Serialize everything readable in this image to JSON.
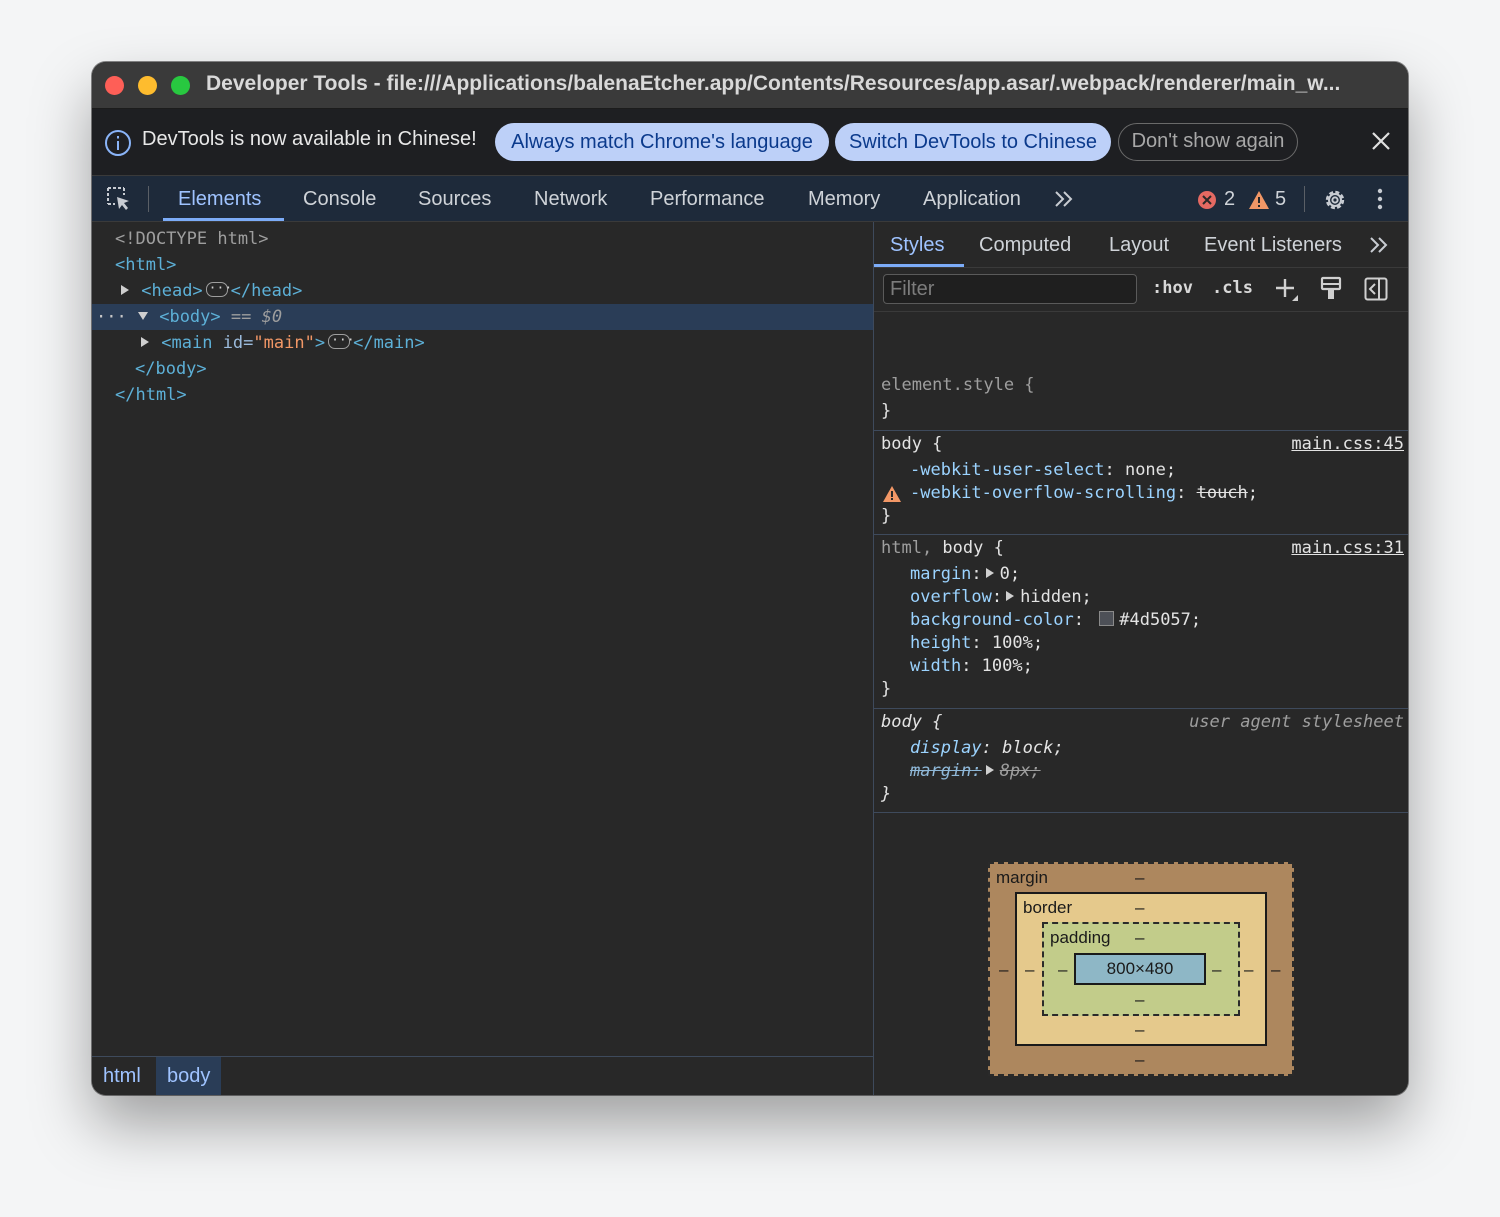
{
  "window": {
    "title": "Developer Tools - file:///Applications/balenaEtcher.app/Contents/Resources/app.asar/.webpack/renderer/main_w..."
  },
  "infobar": {
    "message": "DevTools is now available in Chinese!",
    "buttons": [
      "Always match Chrome's language",
      "Switch DevTools to Chinese",
      "Don't show again"
    ]
  },
  "tabs": [
    "Elements",
    "Console",
    "Sources",
    "Network",
    "Performance",
    "Memory",
    "Application"
  ],
  "active_tab": "Elements",
  "counts": {
    "errors": "2",
    "warnings": "5"
  },
  "dom": {
    "doctype": "<!DOCTYPE html>",
    "html_open": "<html>",
    "head_open": "<head>",
    "head_close": "</head>",
    "body_open": "<body>",
    "body_marker": " == $0",
    "main_tag": "<main",
    "main_attr": "id",
    "main_val": "\"main\"",
    "main_gt": ">",
    "main_close": "</main>",
    "body_close": "</body>",
    "html_close": "</html>"
  },
  "breadcrumbs": [
    "html",
    "body"
  ],
  "styles_tabs": [
    "Styles",
    "Computed",
    "Layout",
    "Event Listeners"
  ],
  "filter": {
    "placeholder": "Filter"
  },
  "toolbar": {
    "hov": ":hov",
    "cls": ".cls"
  },
  "rules": {
    "element_style": {
      "selector": "element.style {",
      "close": "}"
    },
    "body1": {
      "selector": "body {",
      "source": "main.css:45",
      "props": [
        {
          "name": "-webkit-user-select",
          "value": "none;"
        },
        {
          "name": "-webkit-overflow-scrolling",
          "value": "touch"
        }
      ],
      "close": "}"
    },
    "htmlbody": {
      "selector_a": "html, ",
      "selector_b": "body {",
      "source": "main.css:31",
      "props": [
        {
          "name": "margin",
          "value": "0;"
        },
        {
          "name": "overflow",
          "value": "hidden;"
        },
        {
          "name": "background-color",
          "value": "#4d5057;"
        },
        {
          "name": "height",
          "value": "100%;"
        },
        {
          "name": "width",
          "value": "100%;"
        }
      ],
      "close": "}"
    },
    "ua": {
      "selector": "body {",
      "source": "user agent stylesheet",
      "props": [
        {
          "name": "display",
          "value": "block;"
        },
        {
          "name": "margin",
          "value": "8px;"
        }
      ],
      "close": "}"
    }
  },
  "box_model": {
    "margin_label": "margin",
    "border_label": "border",
    "padding_label": "padding",
    "dash": "–",
    "content": "800×480"
  },
  "colors": {
    "traffic_red": "#fe5f57",
    "traffic_yellow": "#febc2e",
    "traffic_green": "#28c840",
    "accent": "#7cacf8",
    "swatch": "#4d5057"
  }
}
